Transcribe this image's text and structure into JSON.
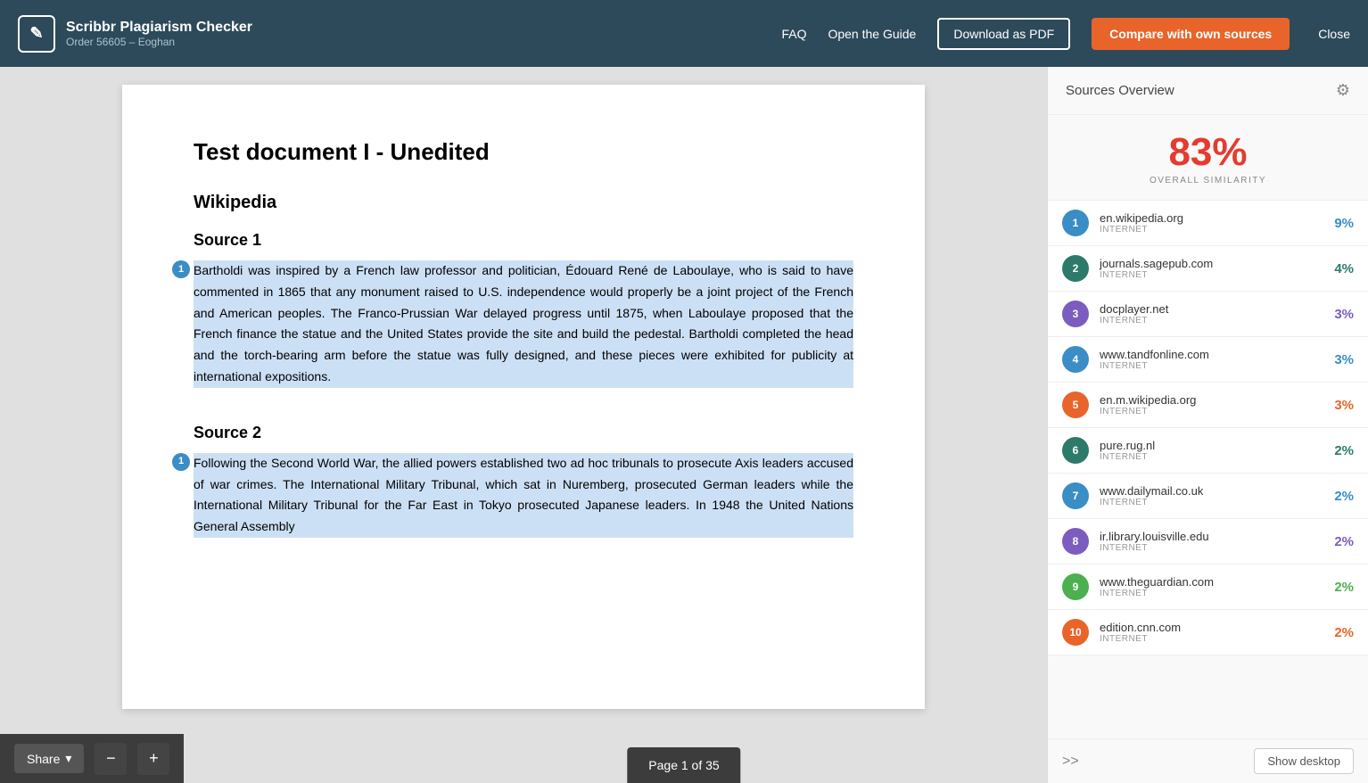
{
  "header": {
    "logo_icon": "✎",
    "app_name": "Scribbr Plagiarism Checker",
    "order_info": "Order 56605 – Eoghan",
    "nav": {
      "faq": "FAQ",
      "guide": "Open the Guide",
      "download": "Download as PDF",
      "compare": "Compare with own sources",
      "close": "Close"
    }
  },
  "document": {
    "title": "Test document I - Unedited",
    "section": "Wikipedia",
    "source1_title": "Source 1",
    "source1_badge": "1",
    "source1_text": "Bartholdi was inspired by a French law professor and politician, Édouard René de Laboulaye, who is said to have commented in 1865 that any monument raised to U.S. independence would properly be a joint project of the French and American peoples. The Franco-Prussian War delayed progress until 1875, when Laboulaye proposed that the French finance the statue and the United States provide the site and build the pedestal. Bartholdi completed the head and the torch-bearing arm before the statue was fully designed, and these pieces were exhibited for publicity at international expositions.",
    "source2_title": "Source 2",
    "source2_badge": "1",
    "source2_text": "Following the Second World War, the allied powers established two ad hoc tribunals to prosecute Axis leaders accused of war crimes. The International Military Tribunal, which sat in Nuremberg, prosecuted German leaders while the International Military Tribunal for the Far East in Tokyo prosecuted Japanese leaders. In 1948 the United Nations General Assembly"
  },
  "toolbar": {
    "share_label": "Share",
    "share_chevron": "▾",
    "zoom_out": "−",
    "zoom_in": "+"
  },
  "page_indicator": {
    "text": "Page 1 of 35"
  },
  "sidebar": {
    "title": "Sources Overview",
    "similarity_pct": "83%",
    "similarity_label": "OVERALL SIMILARITY",
    "show_desktop": "Show desktop",
    "expand": ">>",
    "sources": [
      {
        "num": 1,
        "domain": "en.wikipedia.org",
        "type": "INTERNET",
        "pct": "9%",
        "color": "#3a8dc5"
      },
      {
        "num": 2,
        "domain": "journals.sagepub.com",
        "type": "INTERNET",
        "pct": "4%",
        "color": "#2d7a6b"
      },
      {
        "num": 3,
        "domain": "docplayer.net",
        "type": "INTERNET",
        "pct": "3%",
        "color": "#7c5cbf"
      },
      {
        "num": 4,
        "domain": "www.tandfonline.com",
        "type": "INTERNET",
        "pct": "3%",
        "color": "#3a8dc5"
      },
      {
        "num": 5,
        "domain": "en.m.wikipedia.org",
        "type": "INTERNET",
        "pct": "3%",
        "color": "#e8642a"
      },
      {
        "num": 6,
        "domain": "pure.rug.nl",
        "type": "INTERNET",
        "pct": "2%",
        "color": "#2d7a6b"
      },
      {
        "num": 7,
        "domain": "www.dailymail.co.uk",
        "type": "INTERNET",
        "pct": "2%",
        "color": "#3a8dc5"
      },
      {
        "num": 8,
        "domain": "ir.library.louisville.edu",
        "type": "INTERNET",
        "pct": "2%",
        "color": "#7c5cbf"
      },
      {
        "num": 9,
        "domain": "www.theguardian.com",
        "type": "INTERNET",
        "pct": "2%",
        "color": "#4caf50"
      },
      {
        "num": 10,
        "domain": "edition.cnn.com",
        "type": "INTERNET",
        "pct": "2%",
        "color": "#e8642a"
      }
    ]
  }
}
